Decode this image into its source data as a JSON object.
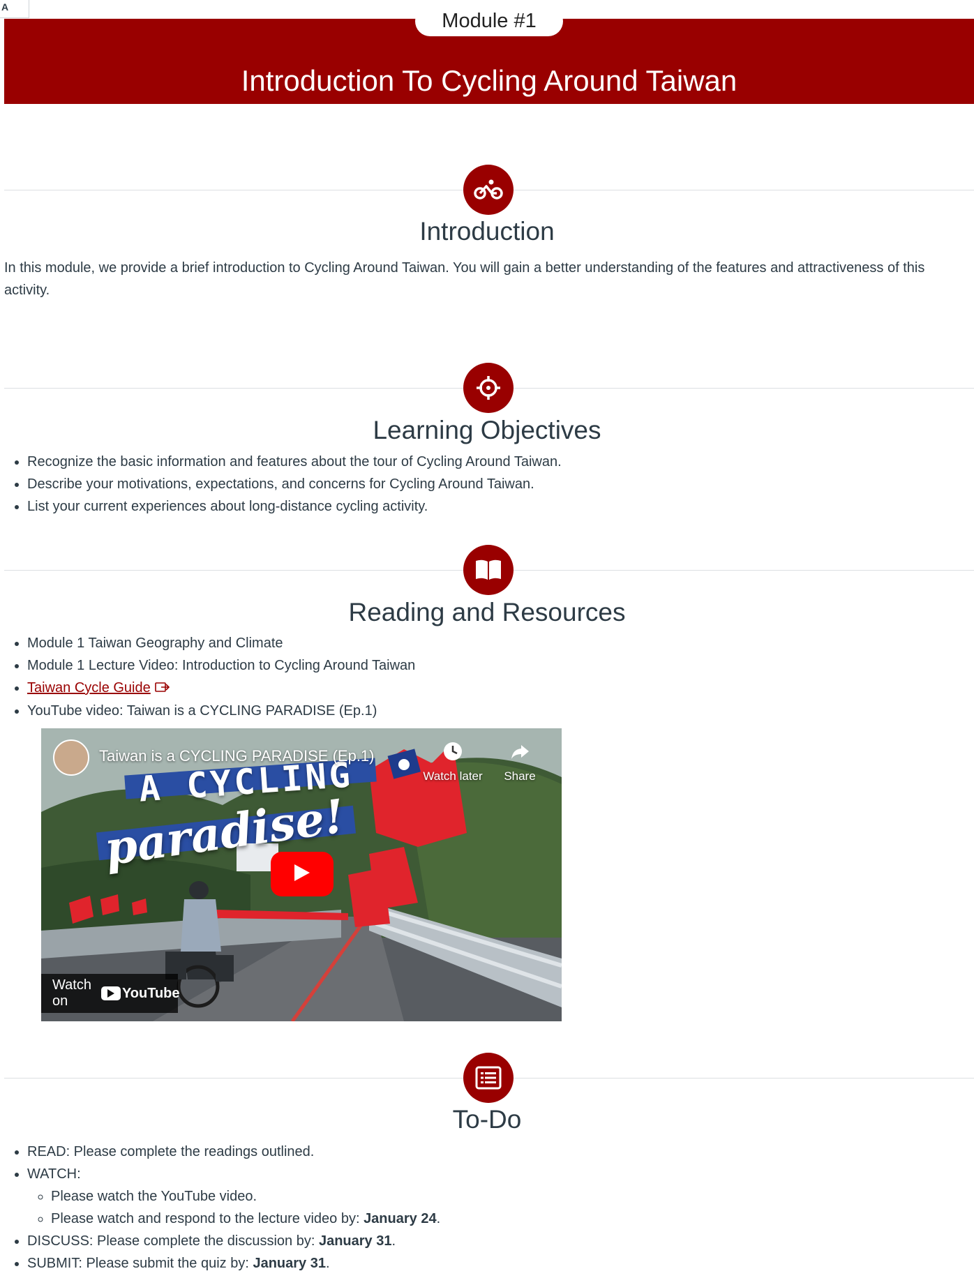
{
  "corner": {
    "icon": "text-size-icon",
    "label": "A"
  },
  "header": {
    "module_label": "Module #1",
    "title": "Introduction To Cycling Around Taiwan",
    "background": "#990000"
  },
  "sections": {
    "introduction": {
      "icon": "bicycle-icon",
      "title": "Introduction",
      "body": "In this module, we provide a brief introduction to Cycling Around Taiwan. You will gain a better understanding of the features and attractiveness of this activity."
    },
    "objectives": {
      "icon": "target-icon",
      "title": "Learning Objectives",
      "items": [
        "Recognize the basic information and features about the tour of Cycling Around Taiwan.",
        "Describe your motivations, expectations, and concerns for Cycling Around Taiwan.",
        "List your current experiences about long-distance cycling activity."
      ]
    },
    "resources": {
      "icon": "book-icon",
      "title": "Reading and Resources",
      "items": [
        "Module 1 Taiwan Geography and Climate",
        "Module 1 Lecture Video: Introduction to Cycling Around Taiwan",
        "Taiwan Cycle Guide",
        "YouTube video: Taiwan is a CYCLING PARADISE (Ep.1)"
      ]
    },
    "video": {
      "title": "Taiwan is a CYCLING PARADISE (Ep.1)",
      "watch_later": "Watch later",
      "share": "Share",
      "watch_on": "Watch on",
      "youtube": "YouTube",
      "overlay_line1": "A CYCLING",
      "overlay_line2": "paradise!"
    },
    "todo": {
      "icon": "list-icon",
      "title": "To-Do",
      "read": "READ: Please complete the readings outlined.",
      "watch": "WATCH:",
      "watch_sub1": "Please watch the YouTube video.",
      "watch_sub2_prefix": "Please watch and respond to the lecture video by: ",
      "watch_sub2_date": "January 24",
      "discuss_prefix": "DISCUSS: Please complete the discussion by: ",
      "discuss_date": "January 31",
      "submit_prefix": "SUBMIT: Please submit the quiz by: ",
      "submit_date": "January 31",
      "period": "."
    }
  }
}
